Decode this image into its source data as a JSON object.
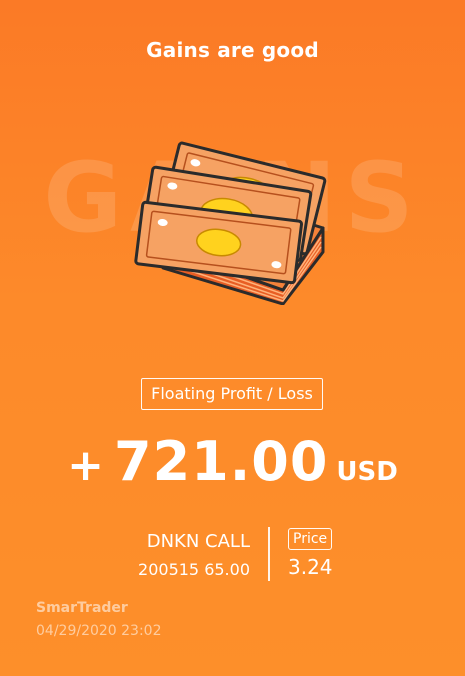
{
  "colors": {
    "background": "#fc8228",
    "text": "#ffffff",
    "bill": "#f6a263",
    "bill_coin": "#ffd21e",
    "stack_side": "#f06a2a",
    "outline": "#2b2b2b"
  },
  "header": {
    "title": "Gains are good"
  },
  "hero": {
    "watermark": "GAINS",
    "illustration": "cash-stack-icon"
  },
  "pnl": {
    "label": "Floating Profit / Loss",
    "sign": "+",
    "value": "721.00",
    "currency": "USD"
  },
  "position": {
    "name": "DNKN CALL",
    "detail": "200515 65.00",
    "price_label": "Price",
    "price_value": "3.24"
  },
  "footer": {
    "brand": "SmarTrader",
    "timestamp": "04/29/2020 23:02"
  }
}
